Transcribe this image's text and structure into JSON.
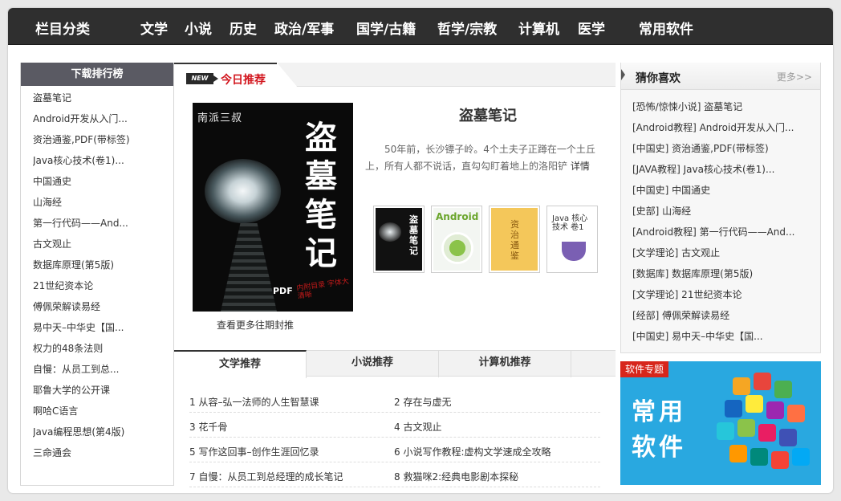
{
  "topnav": {
    "category": "栏目分类",
    "items": [
      "文学",
      "小说",
      "历史",
      "政治/军事",
      "国学/古籍",
      "哲学/宗教",
      "计算机",
      "医学",
      "常用软件"
    ]
  },
  "ranking": {
    "title": "下载排行榜",
    "items": [
      "盗墓笔记",
      "Android开发从入门...",
      "资治通鉴,PDF(带标签)",
      "Java核心技术(卷1)...",
      "中国通史",
      "山海经",
      "第一行代码——And...",
      "古文观止",
      "数据库原理(第5版)",
      "21世纪资本论",
      "傅佩荣解读易经",
      "易中天–中华史【国...",
      "权力的48条法则",
      "自慢：从员工到总...",
      "耶鲁大学的公开课",
      "啊哈C语言",
      "Java编程思想(第4版)",
      "三命通会"
    ]
  },
  "today": {
    "badge": "NEW",
    "tab": "今日推荐",
    "cover": {
      "author": "南派三叔",
      "title_chars": [
        "盗",
        "墓",
        "笔",
        "记"
      ],
      "pdf_mark": "PDF",
      "overlay": "内附目录 字体大 清晰"
    },
    "more_covers": "查看更多往期封推",
    "book_title": "盗墓笔记",
    "book_desc": "50年前，长沙镖子岭。4个土夫子正蹲在一个土丘上，所有人都不说话，直勾勾盯着地上的洛阳铲",
    "more_link": "详情",
    "thumbs": [
      {
        "text": "盗墓笔记"
      },
      {
        "text": "Android"
      },
      {
        "text": "资治通鉴"
      },
      {
        "text": "Java 核心技术 卷1"
      }
    ]
  },
  "subtabs": [
    "文学推荐",
    "小说推荐",
    "计算机推荐"
  ],
  "rec": [
    [
      "1 从容–弘一法师的人生智慧课",
      "2 存在与虚无"
    ],
    [
      "3 花千骨",
      "4 古文观止"
    ],
    [
      "5 写作这回事–创作生涯回忆录",
      "6 小说写作教程:虚构文学速成全攻略"
    ],
    [
      "7 自慢：从员工到总经理的成长笔记",
      "8 救猫咪2:经典电影剧本探秘"
    ]
  ],
  "guess": {
    "title": "猜你喜欢",
    "more": "更多>>",
    "items": [
      "[恐怖/惊悚小说] 盗墓笔记",
      "[Android教程] Android开发从入门...",
      "[中国史] 资治通鉴,PDF(带标签)",
      "[JAVA教程] Java核心技术(卷1)...",
      "[中国史] 中国通史",
      "[史部] 山海经",
      "[Android教程] 第一行代码——And...",
      "[文学理论] 古文观止",
      "[数据库] 数据库原理(第5版)",
      "[文学理论] 21世纪资本论",
      "[经部] 傅佩荣解读易经",
      "[中国史] 易中天–中华史【国..."
    ]
  },
  "banner": {
    "label": "软件专题",
    "text": "常用软件"
  }
}
